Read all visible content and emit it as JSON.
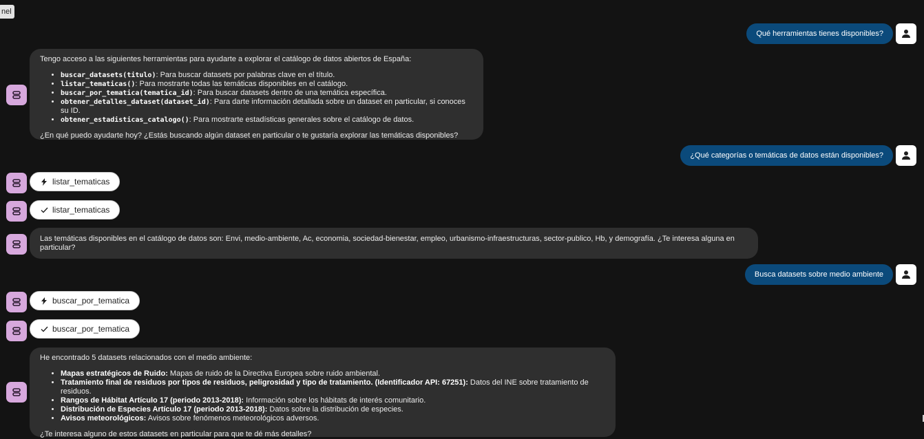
{
  "corner_chip": "nel",
  "conversation": {
    "user_1": "Qué herramientas tienes disponibles?",
    "bot_1": {
      "intro": "Tengo acceso a las siguientes herramientas para ayudarte a explorar el catálogo de datos abiertos de España:",
      "items": [
        {
          "code": "buscar_datasets(titulo)",
          "text": ": Para buscar datasets por palabras clave en el título."
        },
        {
          "code": "listar_tematicas()",
          "text": ": Para mostrarte todas las temáticas disponibles en el catálogo."
        },
        {
          "code": "buscar_por_tematica(tematica_id)",
          "text": ": Para buscar datasets dentro de una temática específica."
        },
        {
          "code": "obtener_detalles_dataset(dataset_id)",
          "text": ": Para darte información detallada sobre un dataset en particular, si conoces su ID."
        },
        {
          "code": "obtener_estadisticas_catalogo()",
          "text": ": Para mostrarte estadísticas generales sobre el catálogo de datos."
        }
      ],
      "outro": "¿En qué puedo ayudarte hoy? ¿Estás buscando algún dataset en particular o te gustaría explorar las temáticas disponibles?"
    },
    "user_2": "¿Qué categorías o temáticas de datos están disponibles?",
    "tool_1_call": "listar_tematicas",
    "tool_1_done": "listar_tematicas",
    "bot_2": "Las temáticas disponibles en el catálogo de datos son: Envi, medio-ambiente, Ac, economia, sociedad-bienestar, empleo, urbanismo-infraestructuras, sector-publico, Hb, y demografía. ¿Te interesa alguna en particular?",
    "user_3": "Busca datasets sobre medio ambiente",
    "tool_2_call": "buscar_por_tematica",
    "tool_2_done": "buscar_por_tematica",
    "bot_3": {
      "intro": "He encontrado 5 datasets relacionados con el medio ambiente:",
      "items": [
        {
          "bold": "Mapas estratégicos de Ruido:",
          "text": " Mapas de ruido de la Directiva Europea sobre ruido ambiental."
        },
        {
          "bold": "Tratamiento final de residuos por tipos de residuos, peligrosidad y tipo de tratamiento. (Identificador API: 67251):",
          "text": " Datos del INE sobre tratamiento de residuos."
        },
        {
          "bold": "Rangos de Hábitat Artículo 17 (periodo 2013-2018):",
          "text": " Información sobre los hábitats de interés comunitario."
        },
        {
          "bold": "Distribución de Especies Artículo 17 (periodo 2013-2018):",
          "text": " Datos sobre la distribución de especies."
        },
        {
          "bold": "Avisos meteorológicos:",
          "text": " Avisos sobre fenómenos meteorológicos adversos."
        }
      ],
      "outro": "¿Te interesa alguno de estos datasets en particular para que te dé más detalles?"
    }
  },
  "colors": {
    "background": "#131313",
    "user_bubble": "#0b4a7b",
    "bot_bubble": "#2f2f2f",
    "bot_avatar": "#d7a8dd",
    "user_avatar": "#ffffff"
  },
  "icons": {
    "user_avatar": "person-icon",
    "bot_avatar": "robot-icon",
    "tool_call": "lightning-bolt-icon",
    "tool_done": "checkmark-icon"
  }
}
